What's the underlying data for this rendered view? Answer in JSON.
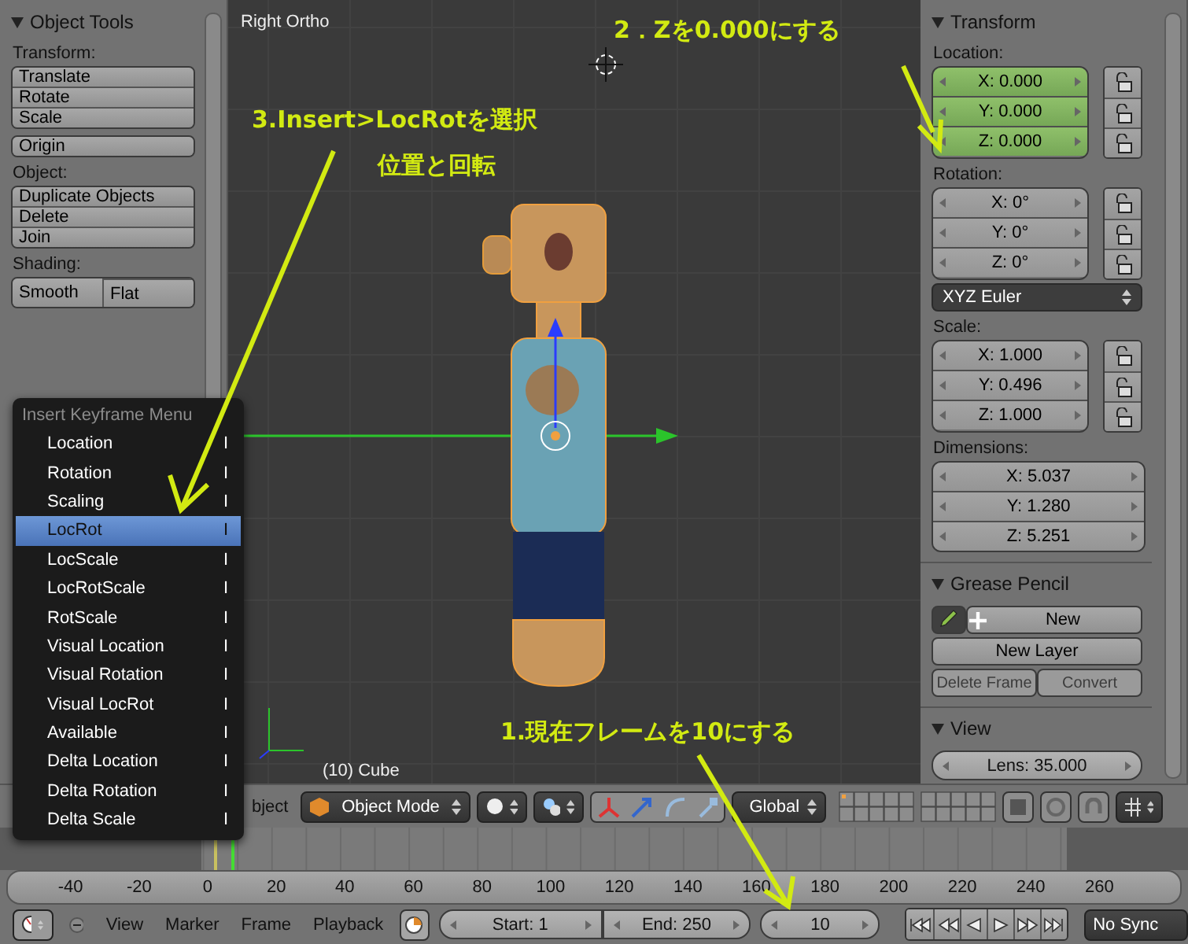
{
  "left_panel": {
    "title": "Object Tools",
    "groups": [
      {
        "label": "Transform:",
        "kind": "column",
        "buttons": [
          "Translate",
          "Rotate",
          "Scale"
        ]
      },
      {
        "kind": "column",
        "buttons": [
          "Origin"
        ]
      },
      {
        "label": "Object:",
        "kind": "column",
        "buttons": [
          "Duplicate Objects",
          "Delete",
          "Join"
        ]
      },
      {
        "label": "Shading:",
        "kind": "row",
        "buttons": [
          "Smooth",
          "Flat"
        ]
      }
    ]
  },
  "viewport": {
    "view_name": "Right Ortho",
    "object_label": "(10) Cube"
  },
  "keyframe_menu": {
    "title": "Insert Keyframe Menu",
    "items": [
      {
        "label": "Location",
        "shortcut": "I",
        "selected": false
      },
      {
        "label": "Rotation",
        "shortcut": "I",
        "selected": false
      },
      {
        "label": "Scaling",
        "shortcut": "I",
        "selected": false
      },
      {
        "label": "LocRot",
        "shortcut": "I",
        "selected": true
      },
      {
        "label": "LocScale",
        "shortcut": "I",
        "selected": false
      },
      {
        "label": "LocRotScale",
        "shortcut": "I",
        "selected": false
      },
      {
        "label": "RotScale",
        "shortcut": "I",
        "selected": false
      },
      {
        "label": "Visual Location",
        "shortcut": "I",
        "selected": false
      },
      {
        "label": "Visual Rotation",
        "shortcut": "I",
        "selected": false
      },
      {
        "label": "Visual LocRot",
        "shortcut": "I",
        "selected": false
      },
      {
        "label": "Available",
        "shortcut": "I",
        "selected": false
      },
      {
        "label": "Delta Location",
        "shortcut": "I",
        "selected": false
      },
      {
        "label": "Delta Rotation",
        "shortcut": "I",
        "selected": false
      },
      {
        "label": "Delta Scale",
        "shortcut": "I",
        "selected": false
      }
    ]
  },
  "right_panel": {
    "transform": {
      "title": "Transform",
      "location": {
        "label": "Location:",
        "fields": [
          {
            "text": "X: 0.000",
            "keyed": true
          },
          {
            "text": "Y: 0.000",
            "keyed": true
          },
          {
            "text": "Z: 0.000",
            "keyed": true
          }
        ]
      },
      "rotation": {
        "label": "Rotation:",
        "fields": [
          {
            "text": "X: 0°",
            "keyed": false
          },
          {
            "text": "Y: 0°",
            "keyed": false
          },
          {
            "text": "Z: 0°",
            "keyed": false
          }
        ]
      },
      "rotation_mode": "XYZ Euler",
      "scale": {
        "label": "Scale:",
        "fields": [
          {
            "text": "X: 1.000",
            "keyed": false
          },
          {
            "text": "Y: 0.496",
            "keyed": false
          },
          {
            "text": "Z: 1.000",
            "keyed": false
          }
        ]
      },
      "dimensions": {
        "label": "Dimensions:",
        "fields": [
          {
            "text": "X: 5.037",
            "keyed": false
          },
          {
            "text": "Y: 1.280",
            "keyed": false
          },
          {
            "text": "Z: 5.251",
            "keyed": false
          }
        ]
      }
    },
    "grease_pencil": {
      "title": "Grease Pencil",
      "new_button": "New",
      "new_layer_button": "New Layer",
      "delete_frame_button": {
        "label": "Delete Frame",
        "disabled": true
      },
      "convert_button": {
        "label": "Convert",
        "disabled": true
      }
    },
    "view": {
      "title": "View",
      "lens": "Lens: 35.000"
    }
  },
  "header": {
    "menu_fragment": "bject",
    "mode": "Object Mode",
    "orientation": "Global"
  },
  "timeline": {
    "ruler_labels": [
      "-40",
      "-20",
      "0",
      "20",
      "40",
      "60",
      "80",
      "100",
      "120",
      "140",
      "160",
      "180",
      "200",
      "220",
      "240",
      "260"
    ]
  },
  "bottom_bar": {
    "menus": [
      "View",
      "Marker",
      "Frame",
      "Playback"
    ],
    "start": "Start: 1",
    "end": "End: 250",
    "current_frame": "10",
    "sync": "No Sync"
  },
  "annotations": [
    {
      "text": "2．Zを0.000にする"
    },
    {
      "text": "3.Insert>LocRotを選択"
    },
    {
      "text": "位置と回転"
    },
    {
      "text": "1.現在フレームを10にする"
    }
  ]
}
